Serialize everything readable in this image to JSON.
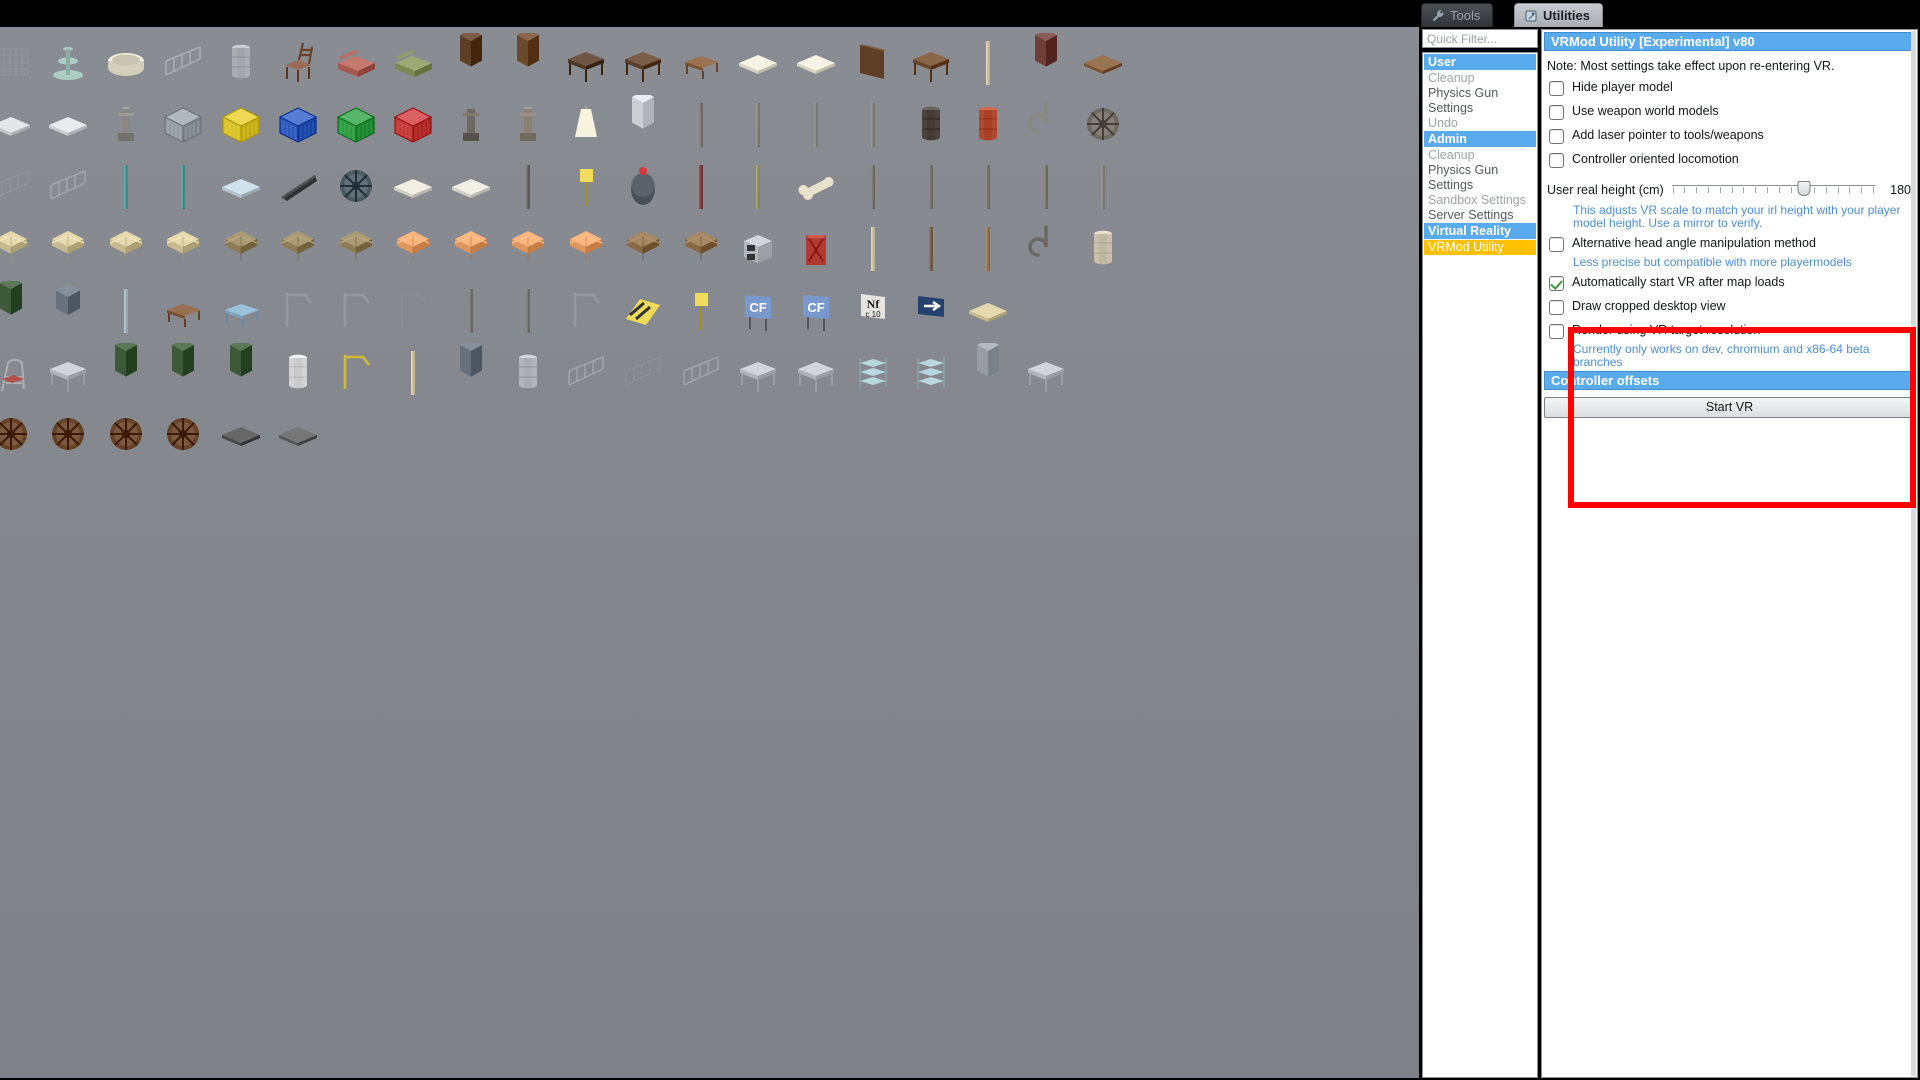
{
  "tabs": [
    {
      "id": "tools",
      "label": "Tools",
      "icon": "wrench-icon",
      "active": false
    },
    {
      "id": "utilities",
      "label": "Utilities",
      "icon": "utilities-icon",
      "active": true
    }
  ],
  "sidebar": {
    "quick_filter_placeholder": "Quick Filter...",
    "groups": [
      {
        "category": "User",
        "items": [
          {
            "label": "Cleanup",
            "selected": false,
            "muted": true
          },
          {
            "label": "Physics Gun Settings",
            "selected": false,
            "muted": false
          },
          {
            "label": "Undo",
            "selected": false,
            "muted": true
          }
        ]
      },
      {
        "category": "Admin",
        "items": [
          {
            "label": "Cleanup",
            "selected": false,
            "muted": true
          },
          {
            "label": "Physics Gun Settings",
            "selected": false,
            "muted": false
          },
          {
            "label": "Sandbox Settings",
            "selected": false,
            "muted": true
          },
          {
            "label": "Server Settings",
            "selected": false,
            "muted": false
          }
        ]
      },
      {
        "category": "Virtual Reality",
        "items": [
          {
            "label": "VRMod Utility",
            "selected": true,
            "muted": false
          }
        ]
      }
    ]
  },
  "panel": {
    "title": "VRMod Utility [Experimental] v80",
    "note": "Note: Most settings take effect upon re-entering VR.",
    "options_top": [
      {
        "label": "Hide player model",
        "checked": false
      },
      {
        "label": "Use weapon world models",
        "checked": false
      },
      {
        "label": "Add laser pointer to tools/weapons",
        "checked": false
      },
      {
        "label": "Controller oriented locomotion",
        "checked": false
      }
    ],
    "height_slider": {
      "label": "User real height (cm)",
      "value": "180",
      "percent": 65,
      "tick_count": 18,
      "hint": "This adjusts VR scale to match your irl height with your player model height. Use a mirror to verify."
    },
    "alt_head": {
      "label": "Alternative head angle manipulation method",
      "checked": false,
      "hint": "Less precise but compatible with more playermodels"
    },
    "options_highlighted": [
      {
        "label": "Automatically start VR after map loads",
        "checked": true,
        "hint": ""
      },
      {
        "label": "Draw cropped desktop view",
        "checked": false,
        "hint": ""
      },
      {
        "label": "Render using VR target resolution",
        "checked": false,
        "hint": "Currently only works on dev, chromium and x86-64 beta branches"
      }
    ],
    "controller_offsets_header": "Controller offsets",
    "start_button": "Start VR"
  },
  "annotation": {
    "highlight_color": "#ff0000"
  },
  "colors": {
    "accent_blue": "#5aabee",
    "selected_yellow": "#ffc000",
    "hint_blue": "#4a8fd4",
    "check_green": "#3a9b3a",
    "viewport_grey": "#83868c"
  },
  "viewport": {
    "description": "Garry's Mod prop spawn menu icon grid",
    "columns": 24,
    "rows": 7
  }
}
